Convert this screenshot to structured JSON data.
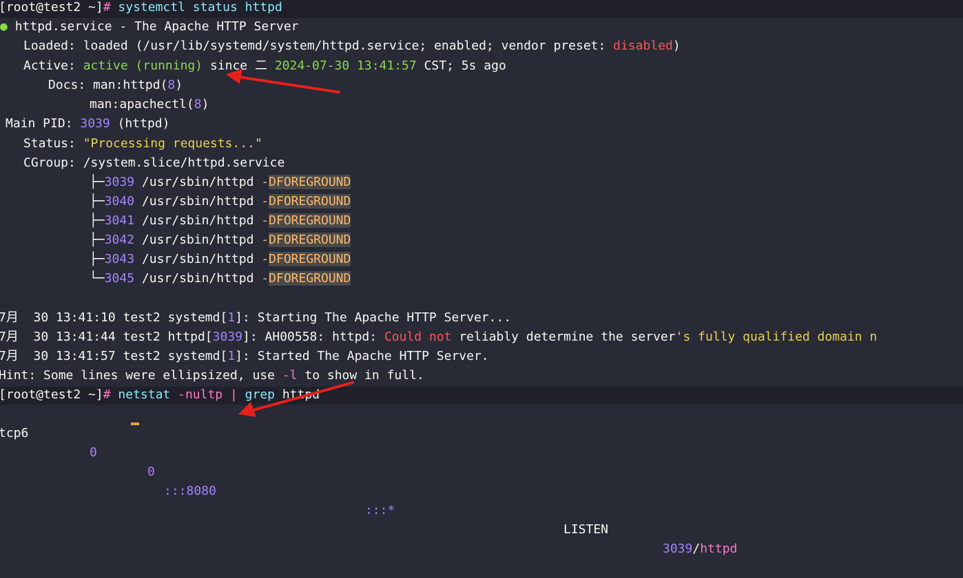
{
  "prompt1": {
    "user": "[root@test2 ~]",
    "sym": "#",
    "cmd": "systemctl status httpd"
  },
  "service": {
    "dot": "●",
    "name": "httpd.service",
    "sep": "-",
    "desc": "The Apache HTTP Server"
  },
  "loaded": {
    "label": "Loaded:",
    "state": "loaded",
    "path": "(/usr/lib/systemd/system/httpd.service;",
    "enabled": "enabled;",
    "vendor_label": "vendor preset:",
    "vendor_value": "disabled",
    "close": ")"
  },
  "active": {
    "label": "Active:",
    "state": "active (running)",
    "since": "since",
    "weekday": "二",
    "timestamp": "2024-07-30 13:41:57",
    "tz": "CST;",
    "ago": "5s ago"
  },
  "docs": {
    "label": "Docs:",
    "man1_prefix": "man:",
    "man1_name": "httpd(",
    "man1_num": "8",
    "man1_close": ")",
    "man2_prefix": "man:",
    "man2_name": "apachectl(",
    "man2_num": "8",
    "man2_close": ")"
  },
  "mainpid": {
    "label": "Main PID:",
    "pid": "3039",
    "name": "(httpd)"
  },
  "status": {
    "label": "Status:",
    "value": "\"Processing requests...\""
  },
  "cgroup": {
    "label": "CGroup:",
    "value": "/system.slice/httpd.service"
  },
  "processes": [
    {
      "tree": "├─",
      "pid": "3039",
      "cmd": "/usr/sbin/httpd",
      "dash": "-",
      "flag": "DFOREGROUND"
    },
    {
      "tree": "├─",
      "pid": "3040",
      "cmd": "/usr/sbin/httpd",
      "dash": "-",
      "flag": "DFOREGROUND"
    },
    {
      "tree": "├─",
      "pid": "3041",
      "cmd": "/usr/sbin/httpd",
      "dash": "-",
      "flag": "DFOREGROUND"
    },
    {
      "tree": "├─",
      "pid": "3042",
      "cmd": "/usr/sbin/httpd",
      "dash": "-",
      "flag": "DFOREGROUND"
    },
    {
      "tree": "├─",
      "pid": "3043",
      "cmd": "/usr/sbin/httpd",
      "dash": "-",
      "flag": "DFOREGROUND"
    },
    {
      "tree": "└─",
      "pid": "3045",
      "cmd": "/usr/sbin/httpd",
      "dash": "-",
      "flag": "DFOREGROUND"
    }
  ],
  "logs": [
    {
      "date": "7月  30",
      "time": "13:41:10",
      "host": "test2",
      "proc": "systemd[",
      "pid": "1",
      "proc_close": "]:",
      "msg": "Starting The Apache HTTP Server..."
    },
    {
      "date": "7月  30",
      "time": "13:41:44",
      "host": "test2",
      "proc": "httpd[",
      "pid": "3039",
      "proc_close": "]:",
      "msg_a": "AH00558: httpd:",
      "msg_err": "Could not",
      "msg_b": "reliably determine the server",
      "msg_q": "'s fully qualified domain n"
    },
    {
      "date": "7月  30",
      "time": "13:41:57",
      "host": "test2",
      "proc": "systemd[",
      "pid": "1",
      "proc_close": "]:",
      "msg": "Started The Apache HTTP Server."
    }
  ],
  "hint": {
    "label": "Hint:",
    "text_a": "Some lines were ellipsized, use",
    "flag": "-l",
    "text_b": "to show in full."
  },
  "prompt2": {
    "user": "[root@test2 ~]",
    "sym": "#",
    "cmd": "netstat",
    "opts": "-nultp",
    "pipe": "|",
    "grep": "grep",
    "arg": "httpd"
  },
  "netstat_row": {
    "proto": "tcp6",
    "recvq": "0",
    "sendq": "0",
    "local": ":::8080",
    "foreign": ":::*",
    "state": "LISTEN",
    "pid": "3039",
    "slash": "/",
    "prog": "httpd"
  },
  "annotations": {
    "arrow_color": "#e8201b"
  }
}
